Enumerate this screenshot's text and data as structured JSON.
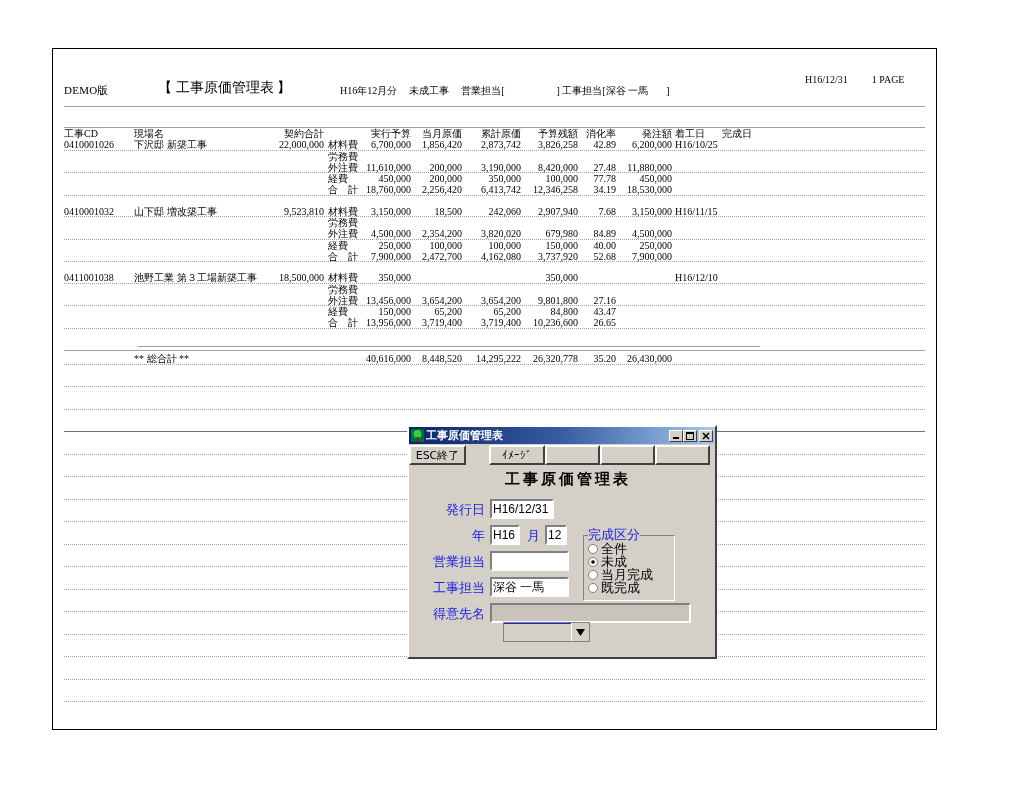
{
  "report": {
    "edition": "DEMO版",
    "title": "【 工事原価管理表 】",
    "header_items": [
      "H16年12月分",
      "未成工事",
      "営業担当[",
      "] 工事担当[深谷 一馬",
      "]"
    ],
    "date": "H16/12/31",
    "page": "1 PAGE",
    "columns": {
      "code": "工事CD",
      "name": "現場名",
      "contract": "契約合計",
      "budget": "実行予算",
      "month_cost": "当月原価",
      "total_cost": "累計原価",
      "remaining": "予算残額",
      "rate": "消化率",
      "order": "発注額",
      "start": "着工日",
      "end": "完成日"
    },
    "projects": [
      {
        "code": "0410001026",
        "name": "下沢邸 新築工事",
        "contract": "22,000,000",
        "start": "H16/10/25",
        "lines": [
          {
            "category": "材料費",
            "budget": "6,700,000",
            "month_cost": "1,856,420",
            "total_cost": "2,873,742",
            "remaining": "3,826,258",
            "rate": "42.89",
            "order": "6,200,000"
          },
          {
            "category": "労務費"
          },
          {
            "category": "外注費",
            "budget": "11,610,000",
            "month_cost": "200,000",
            "total_cost": "3,190,000",
            "remaining": "8,420,000",
            "rate": "27.48",
            "order": "11,880,000"
          },
          {
            "category": "経費",
            "budget": "450,000",
            "month_cost": "200,000",
            "total_cost": "350,000",
            "remaining": "100,000",
            "rate": "77.78",
            "order": "450,000"
          },
          {
            "category": "合　計",
            "budget": "18,760,000",
            "month_cost": "2,256,420",
            "total_cost": "6,413,742",
            "remaining": "12,346,258",
            "rate": "34.19",
            "order": "18,530,000"
          }
        ]
      },
      {
        "code": "0410001032",
        "name": "山下邸 増改築工事",
        "contract": "9,523,810",
        "start": "H16/11/15",
        "lines": [
          {
            "category": "材料費",
            "budget": "3,150,000",
            "month_cost": "18,500",
            "total_cost": "242,060",
            "remaining": "2,907,940",
            "rate": "7.68",
            "order": "3,150,000"
          },
          {
            "category": "労務費"
          },
          {
            "category": "外注費",
            "budget": "4,500,000",
            "month_cost": "2,354,200",
            "total_cost": "3,820,020",
            "remaining": "679,980",
            "rate": "84.89",
            "order": "4,500,000"
          },
          {
            "category": "経費",
            "budget": "250,000",
            "month_cost": "100,000",
            "total_cost": "100,000",
            "remaining": "150,000",
            "rate": "40.00",
            "order": "250,000"
          },
          {
            "category": "合　計",
            "budget": "7,900,000",
            "month_cost": "2,472,700",
            "total_cost": "4,162,080",
            "remaining": "3,737,920",
            "rate": "52.68",
            "order": "7,900,000"
          }
        ]
      },
      {
        "code": "0411001038",
        "name": "池野工業 第３工場新築工事",
        "contract": "18,500,000",
        "start": "H16/12/10",
        "lines": [
          {
            "category": "材料費",
            "budget": "350,000",
            "remaining": "350,000"
          },
          {
            "category": "労務費"
          },
          {
            "category": "外注費",
            "budget": "13,456,000",
            "month_cost": "3,654,200",
            "total_cost": "3,654,200",
            "remaining": "9,801,800",
            "rate": "27.16"
          },
          {
            "category": "経費",
            "budget": "150,000",
            "month_cost": "65,200",
            "total_cost": "65,200",
            "remaining": "84,800",
            "rate": "43.47"
          },
          {
            "category": "合　計",
            "budget": "13,956,000",
            "month_cost": "3,719,400",
            "total_cost": "3,719,400",
            "remaining": "10,236,600",
            "rate": "26.65"
          }
        ]
      }
    ],
    "grand_total": {
      "label": "** 総合計 **",
      "budget": "40,616,000",
      "month_cost": "8,448,520",
      "total_cost": "14,295,222",
      "remaining": "26,320,778",
      "rate": "35.20",
      "order": "26,430,000"
    }
  },
  "dialog": {
    "title": "工事原価管理表",
    "toolbar": [
      {
        "label": "ESC終了"
      },
      {
        "label": "ｲﾒｰｼﾞ"
      }
    ],
    "heading": "工事原価管理表",
    "issue_date": {
      "label": "発行日",
      "value": "H16/12/31"
    },
    "year": {
      "label": "年",
      "value": "H16"
    },
    "month": {
      "label": "月",
      "value": "12"
    },
    "sales_rep": {
      "label": "営業担当"
    },
    "construction_rep": {
      "label": "工事担当",
      "value": "深谷 一馬"
    },
    "customer": {
      "label": "得意先名",
      "disabled": true
    },
    "completion": {
      "label": "完成区分",
      "options": [
        {
          "label": "全件",
          "selected": false
        },
        {
          "label": "未成",
          "selected": true
        },
        {
          "label": "当月完成",
          "selected": false
        },
        {
          "label": "既完成",
          "selected": false
        }
      ]
    }
  }
}
